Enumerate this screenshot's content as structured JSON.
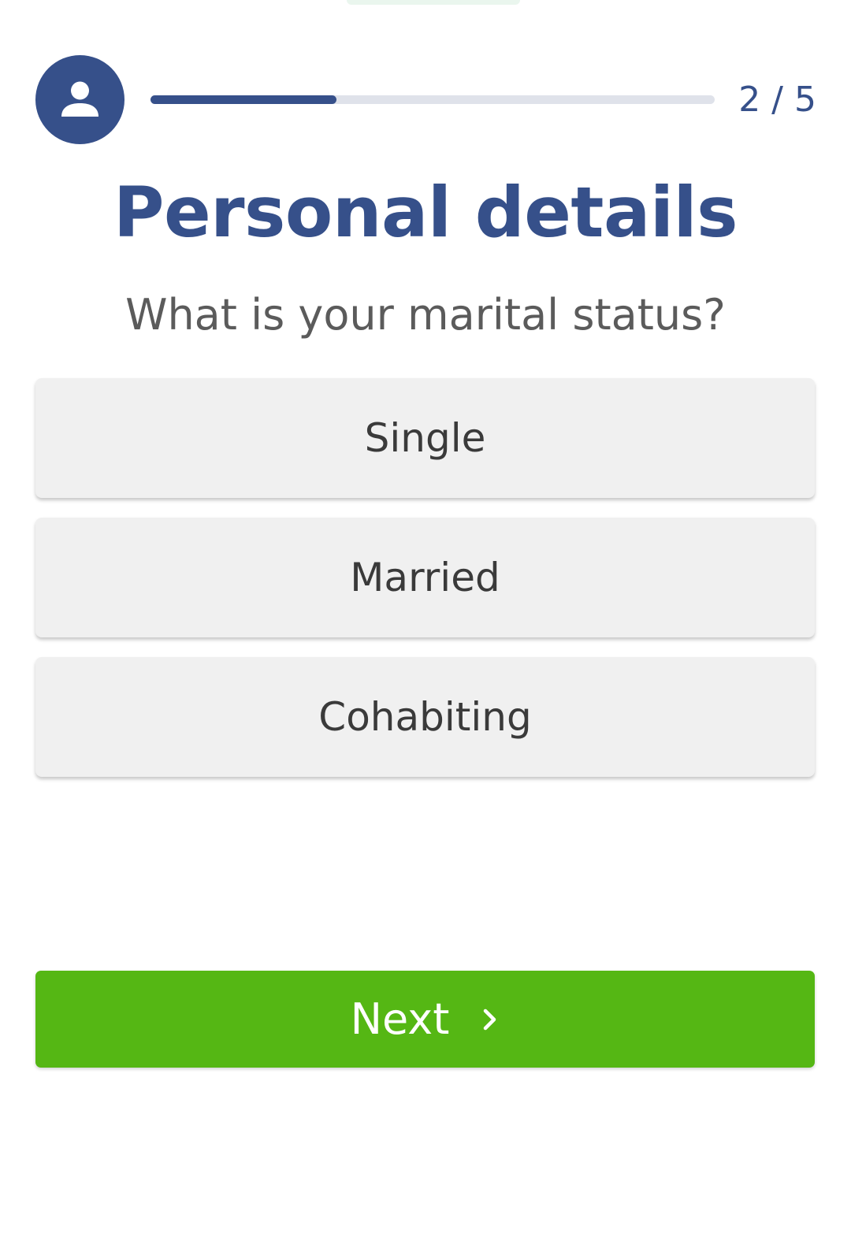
{
  "header": {
    "avatar_icon": "person-icon",
    "progress": {
      "current_step": 2,
      "total_steps": 5,
      "fill_fraction": 0.33,
      "counter_text": "2 / 5"
    }
  },
  "main": {
    "title": "Personal details",
    "question": "What is your marital status?",
    "options": [
      {
        "label": "Single"
      },
      {
        "label": "Married"
      },
      {
        "label": "Cohabiting"
      }
    ]
  },
  "footer": {
    "next_label": "Next",
    "next_icon": "chevron-right-icon"
  },
  "colors": {
    "brand_blue": "#36508a",
    "option_bg": "#f0f0f0",
    "next_green": "#55b714",
    "track_gray": "#dfe2ea"
  }
}
